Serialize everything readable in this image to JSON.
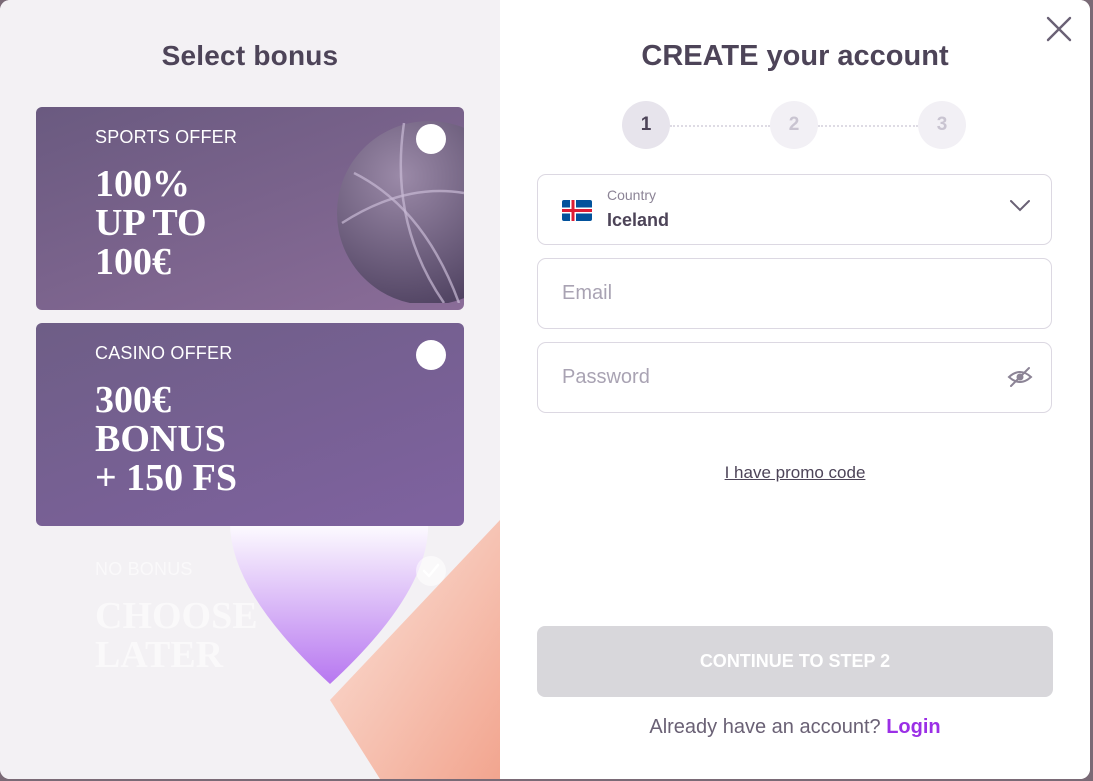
{
  "left": {
    "title": "Select bonus",
    "offers": [
      {
        "label": "SPORTS OFFER",
        "amount": "100%\nUP TO\n100€",
        "selected": false
      },
      {
        "label": "CASINO OFFER",
        "amount": "300€\nBONUS\n+ 150 FS",
        "selected": false
      },
      {
        "label": "NO BONUS",
        "amount": "CHOOSE\nLATER",
        "selected": true
      }
    ]
  },
  "right": {
    "title": "CREATE your account",
    "steps": [
      "1",
      "2",
      "3"
    ],
    "active_step": 1,
    "country": {
      "label": "Country",
      "value": "Iceland"
    },
    "email": {
      "placeholder": "Email"
    },
    "password": {
      "placeholder": "Password"
    },
    "promo_link": "I have promo code",
    "continue_button": "CONTINUE TO STEP 2",
    "login_prompt": "Already have an account?",
    "login_link": "Login"
  },
  "icons": {
    "close": "close-icon",
    "chevron": "chevron-down-icon",
    "eye": "eye-off-icon",
    "flag": "iceland-flag-icon"
  },
  "colors": {
    "accent": "#9b2fe6",
    "title": "#4d4458",
    "button_disabled": "#d8d7db"
  }
}
